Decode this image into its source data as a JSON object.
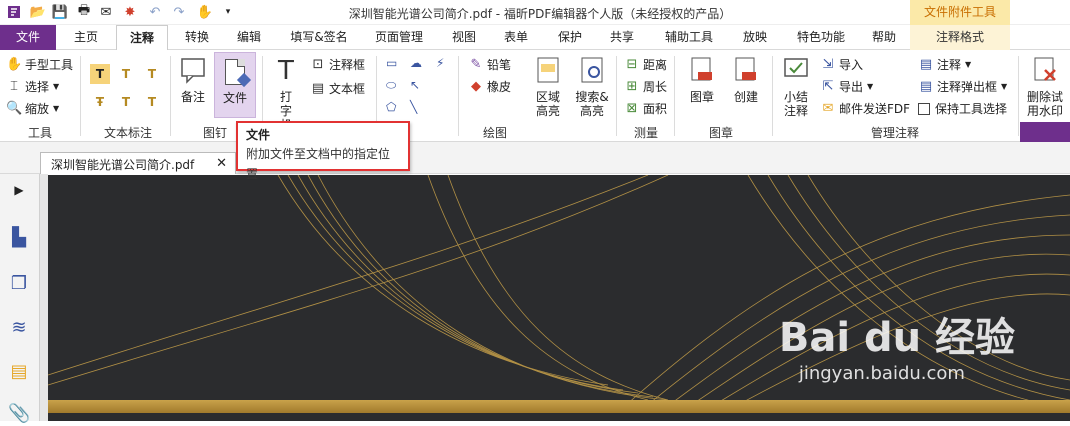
{
  "window": {
    "title": "深圳智能光谱公司简介.pdf - 福昕PDF编辑器个人版（未经授权的产品）",
    "context_tab": "文件附件工具"
  },
  "menu": {
    "tabs": [
      "文件",
      "主页",
      "注释",
      "转换",
      "编辑",
      "填写&签名",
      "页面管理",
      "视图",
      "表单",
      "保护",
      "共享",
      "辅助工具",
      "放映",
      "特色功能",
      "帮助",
      "注释格式"
    ]
  },
  "ribbon": {
    "tools": {
      "hand": "手型工具",
      "select": "选择",
      "zoom": "缩放",
      "group": "工具"
    },
    "text_markup": {
      "group": "文本标注"
    },
    "pin": {
      "note": "备注",
      "file": "文件",
      "group": "图钉"
    },
    "typewriter": {
      "type": "打字机",
      "callout": "注释框",
      "textbox": "文本框"
    },
    "drawing": {
      "pencil": "铅笔",
      "eraser": "橡皮",
      "area_highlight": "区域高亮",
      "search_highlight": "搜索&高亮",
      "group": "绘图"
    },
    "measure": {
      "distance": "距离",
      "perimeter": "周长",
      "area": "面积",
      "group": "测量"
    },
    "stamp": {
      "stamp": "图章",
      "create": "创建",
      "group": "图章"
    },
    "manage": {
      "summary": "小结注释",
      "import": "导入",
      "export": "导出",
      "email": "邮件发送FDF",
      "comments": "注释",
      "popup": "注释弹出框",
      "keep": "保持工具选择",
      "group": "管理注释"
    },
    "watermark_delete": "删除试用水印"
  },
  "tooltip": {
    "title": "文件",
    "description": "附加文件至文档中的指定位置"
  },
  "document": {
    "tab_name": "深圳智能光谱公司简介.pdf",
    "watermark_logo": "Bai du 经验",
    "watermark_url": "jingyan.baidu.com"
  },
  "colors": {
    "file_tab": "#6e2f8c",
    "context_tab_bg": "#fbe9a8",
    "tooltip_border": "#e23232",
    "gold": "#c9a24a",
    "doc_bg": "#2b2c2e"
  }
}
